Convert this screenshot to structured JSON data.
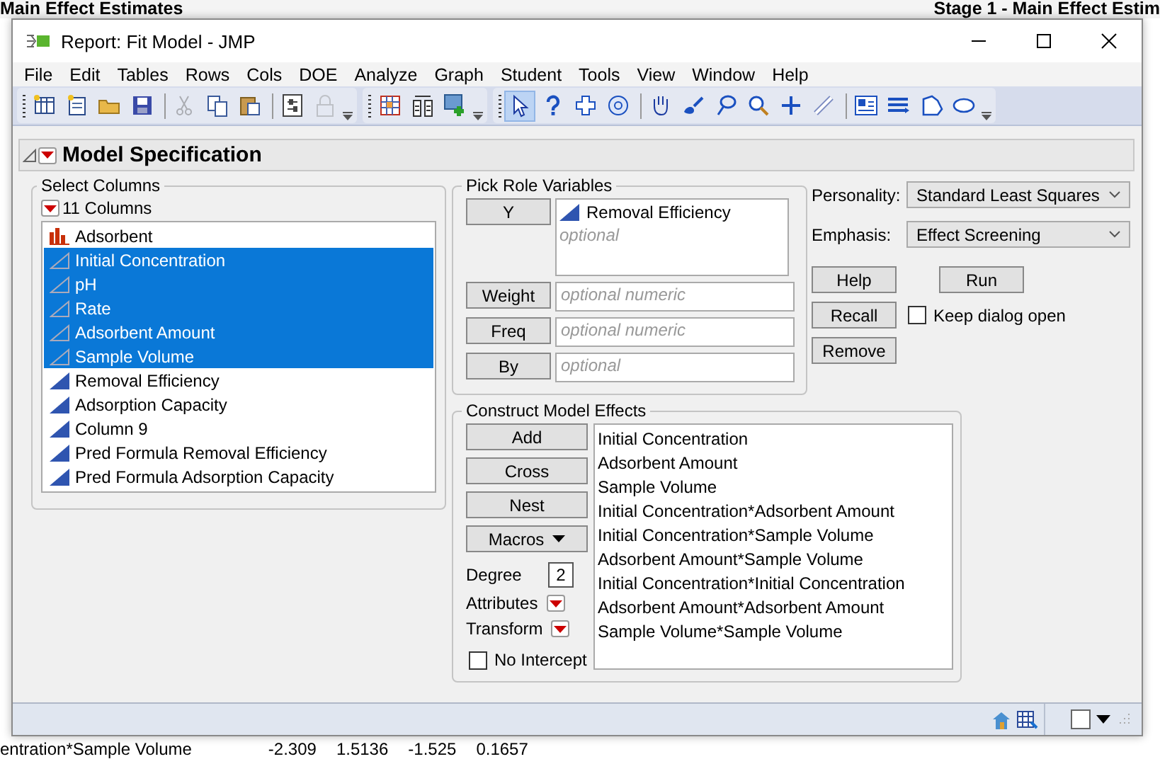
{
  "background": {
    "titles": [
      "Main Effect Estimates",
      "Stage 1 - Main Effect Estim"
    ],
    "bottom_row": {
      "term": "entration*Sample Volume",
      "values": [
        "-2.309",
        "1.5136",
        "-1.525",
        "0.1657"
      ]
    }
  },
  "window": {
    "title": "Report: Fit Model - JMP"
  },
  "menu": [
    "File",
    "Edit",
    "Tables",
    "Rows",
    "Cols",
    "DOE",
    "Analyze",
    "Graph",
    "Student",
    "Tools",
    "View",
    "Window",
    "Help"
  ],
  "toolbar": [
    [
      {
        "disabled": false,
        "selected": false
      },
      {
        "disabled": false,
        "selected": false
      },
      {
        "disabled": false,
        "selected": false
      },
      {
        "disabled": false,
        "selected": false
      },
      {
        "disabled": true,
        "selected": false
      },
      {
        "disabled": false,
        "selected": false
      },
      {
        "disabled": false,
        "selected": false
      },
      {
        "disabled": false,
        "selected": false
      },
      {
        "disabled": true,
        "selected": false
      }
    ],
    [
      {
        "disabled": false,
        "selected": false
      },
      {
        "disabled": false,
        "selected": false
      },
      {
        "disabled": false,
        "selected": false
      }
    ],
    [
      {
        "disabled": false,
        "selected": true
      },
      {
        "disabled": false,
        "selected": false
      },
      {
        "disabled": false,
        "selected": false
      },
      {
        "disabled": false,
        "selected": false
      },
      {
        "disabled": false,
        "selected": false
      },
      {
        "disabled": false,
        "selected": false
      },
      {
        "disabled": false,
        "selected": false
      },
      {
        "disabled": false,
        "selected": false
      },
      {
        "disabled": false,
        "selected": false
      },
      {
        "disabled": false,
        "selected": false
      },
      {
        "disabled": false,
        "selected": false
      },
      {
        "disabled": false,
        "selected": false
      },
      {
        "disabled": false,
        "selected": false
      },
      {
        "disabled": false,
        "selected": false
      }
    ]
  ],
  "outline": {
    "title": "Model Specification"
  },
  "select_columns": {
    "title": "Select Columns",
    "count": "11 Columns",
    "items": [
      {
        "name": "Adsorbent",
        "kind": "nominal",
        "selected": false
      },
      {
        "name": "Initial Concentration",
        "kind": "continuous",
        "selected": true
      },
      {
        "name": "pH",
        "kind": "continuous",
        "selected": true
      },
      {
        "name": "Rate",
        "kind": "continuous",
        "selected": true
      },
      {
        "name": "Adsorbent Amount",
        "kind": "continuous",
        "selected": true
      },
      {
        "name": "Sample Volume",
        "kind": "continuous",
        "selected": true
      },
      {
        "name": "Removal Efficiency",
        "kind": "continuous",
        "selected": false
      },
      {
        "name": "Adsorption Capacity",
        "kind": "continuous",
        "selected": false
      },
      {
        "name": "Column 9",
        "kind": "continuous",
        "selected": false
      },
      {
        "name": "Pred Formula Removal Efficiency",
        "kind": "continuous",
        "selected": false
      },
      {
        "name": "Pred Formula Adsorption Capacity",
        "kind": "continuous",
        "selected": false
      }
    ]
  },
  "pick_roles": {
    "title": "Pick Role Variables",
    "roles": [
      {
        "button": "Y",
        "kind": "list",
        "items": [
          "Removal Efficiency"
        ],
        "placeholder": "optional"
      },
      {
        "button": "Weight",
        "kind": "single",
        "placeholder": "optional numeric"
      },
      {
        "button": "Freq",
        "kind": "single",
        "placeholder": "optional numeric"
      },
      {
        "button": "By",
        "kind": "single",
        "placeholder": "optional"
      }
    ]
  },
  "options": [
    {
      "label": "Personality:",
      "value": "Standard Least Squares"
    },
    {
      "label": "Emphasis:",
      "value": "Effect Screening"
    }
  ],
  "actions": {
    "help": "Help",
    "run": "Run",
    "recall": "Recall",
    "remove": "Remove"
  },
  "keep_open": {
    "label": "Keep dialog open",
    "checked": false
  },
  "construct": {
    "title": "Construct Model Effects",
    "buttons": [
      {
        "label": "Add",
        "menu": false
      },
      {
        "label": "Cross",
        "menu": false
      },
      {
        "label": "Nest",
        "menu": false
      },
      {
        "label": "Macros",
        "menu": true
      }
    ],
    "degree": {
      "label": "Degree",
      "value": "2"
    },
    "menus": [
      "Attributes",
      "Transform"
    ],
    "no_intercept": {
      "label": "No Intercept",
      "checked": false
    },
    "effects": [
      "Initial Concentration",
      "Adsorbent Amount",
      "Sample Volume",
      "Initial Concentration*Adsorbent Amount",
      "Initial Concentration*Sample Volume",
      "Adsorbent Amount*Sample Volume",
      "Initial Concentration*Initial Concentration",
      "Adsorbent Amount*Adsorbent Amount",
      "Sample Volume*Sample Volume"
    ]
  }
}
